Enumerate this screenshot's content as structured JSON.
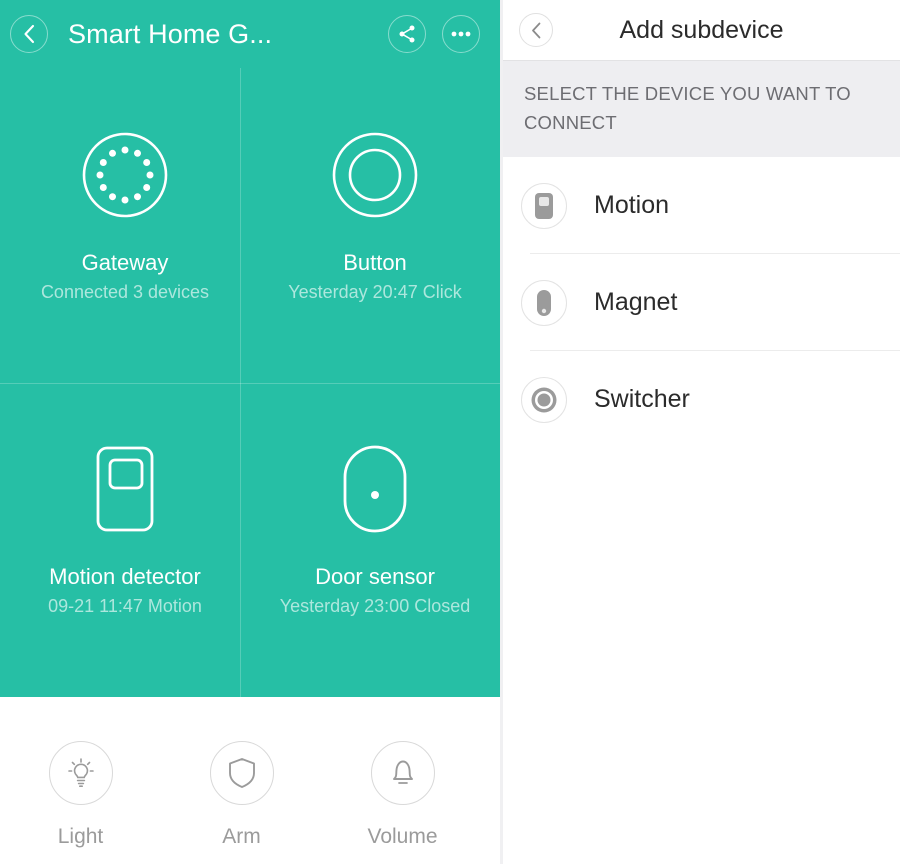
{
  "theme": {
    "accent": "#26bfa5",
    "band_bg": "#eeeef1",
    "muted_text": "#6d6d72",
    "icon_gray": "#9b9b9b"
  },
  "left_panel": {
    "header": {
      "back_icon": "chevron-left-icon",
      "title": "Smart Home G...",
      "share_icon": "share-icon",
      "more_icon": "more-options-icon"
    },
    "tiles": [
      {
        "icon": "gateway-icon",
        "name": "Gateway",
        "status": "Connected 3 devices"
      },
      {
        "icon": "button-icon",
        "name": "Button",
        "status": "Yesterday 20:47 Click"
      },
      {
        "icon": "motion-detector-icon",
        "name": "Motion detector",
        "status": "09-21 11:47 Motion"
      },
      {
        "icon": "door-sensor-icon",
        "name": "Door sensor",
        "status": "Yesterday 23:00 Closed"
      }
    ],
    "bottom_bar": [
      {
        "icon": "lightbulb-icon",
        "label": "Light"
      },
      {
        "icon": "shield-icon",
        "label": "Arm"
      },
      {
        "icon": "bell-icon",
        "label": "Volume"
      }
    ]
  },
  "right_panel": {
    "header": {
      "back_icon": "chevron-left-icon",
      "title": "Add subdevice"
    },
    "section_heading": "SELECT THE DEVICE YOU WANT TO CONNECT",
    "devices": [
      {
        "icon": "motion-device-icon",
        "label": "Motion"
      },
      {
        "icon": "magnet-device-icon",
        "label": "Magnet"
      },
      {
        "icon": "switcher-device-icon",
        "label": "Switcher"
      }
    ]
  }
}
